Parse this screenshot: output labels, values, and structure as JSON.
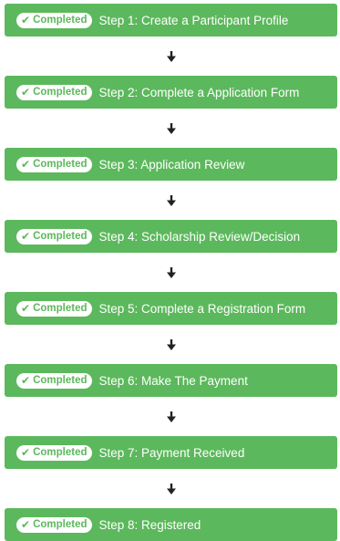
{
  "badge_label": "Completed",
  "icons": {
    "check": "check-icon",
    "arrow": "arrow-down-icon"
  },
  "colors": {
    "step_background": "#5cb85c",
    "badge_background": "#ffffff",
    "badge_text": "#5cb85c",
    "label_text": "#ffffff",
    "arrow": "#222222"
  },
  "steps": [
    {
      "label": "Step 1: Create a Participant Profile",
      "status": "Completed"
    },
    {
      "label": "Step 2: Complete a Application Form",
      "status": "Completed"
    },
    {
      "label": "Step 3: Application Review",
      "status": "Completed"
    },
    {
      "label": "Step 4: Scholarship Review/Decision",
      "status": "Completed"
    },
    {
      "label": "Step 5: Complete a Registration Form",
      "status": "Completed"
    },
    {
      "label": "Step 6: Make The Payment",
      "status": "Completed"
    },
    {
      "label": "Step 7: Payment Received",
      "status": "Completed"
    },
    {
      "label": "Step 8: Registered",
      "status": "Completed"
    }
  ]
}
